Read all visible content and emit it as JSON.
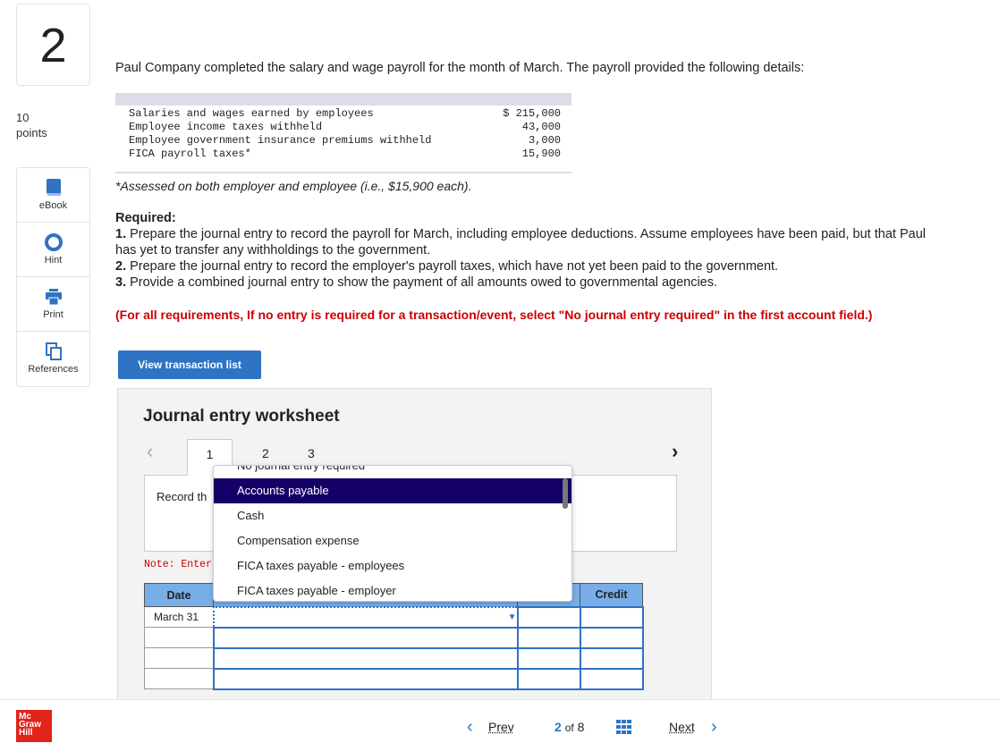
{
  "question": {
    "number": "2",
    "points_value": "10",
    "points_label": "points"
  },
  "sidebar": {
    "items": [
      {
        "label": "eBook",
        "icon": "book-icon"
      },
      {
        "label": "Hint",
        "icon": "lifebuoy-icon"
      },
      {
        "label": "Print",
        "icon": "printer-icon"
      },
      {
        "label": "References",
        "icon": "copy-icon"
      }
    ]
  },
  "intro": "Paul Company completed the salary and wage payroll for the month of March. The payroll provided the following details:",
  "details": [
    {
      "label": "Salaries and wages earned by employees",
      "value": "$ 215,000"
    },
    {
      "label": "Employee income taxes withheld",
      "value": "43,000"
    },
    {
      "label": "Employee government insurance premiums withheld",
      "value": "3,000"
    },
    {
      "label": "FICA payroll taxes*",
      "value": "15,900"
    }
  ],
  "footnote": "*Assessed on both employer and employee (i.e., $15,900 each).",
  "required": {
    "title": "Required:",
    "items": [
      {
        "num": "1.",
        "text": " Prepare the journal entry to record the payroll for March, including employee deductions. Assume employees have been paid, but that Paul has yet to transfer any withholdings to the government."
      },
      {
        "num": "2.",
        "text": " Prepare the journal entry to record the employer's payroll taxes, which have not yet been paid to the government."
      },
      {
        "num": "3.",
        "text": " Provide a combined journal entry to show the payment of all amounts owed to governmental agencies."
      }
    ],
    "instruction": "(For all requirements, If no entry is required for a transaction/event, select \"No journal entry required\" in the first account field.)"
  },
  "view_button": "View transaction list",
  "worksheet": {
    "title": "Journal entry worksheet",
    "tabs": [
      "1",
      "2",
      "3"
    ],
    "record_text": "Record th",
    "note": "Note: Enter de",
    "columns": {
      "date": "Date",
      "credit": "Credit"
    },
    "first_date": "March 31"
  },
  "dropdown": {
    "options": [
      "No journal entry required",
      "Accounts payable",
      "Cash",
      "Compensation expense",
      "FICA taxes payable - employees",
      "FICA taxes payable - employer"
    ],
    "selected": "Accounts payable"
  },
  "footer": {
    "logo": "Mc Graw Hill Education",
    "prev": "Prev",
    "current": "2",
    "of": "of",
    "total": "8",
    "next": "Next"
  },
  "colors": {
    "accent": "#2f73c4",
    "selected": "#150067",
    "alert": "#cc0000"
  }
}
